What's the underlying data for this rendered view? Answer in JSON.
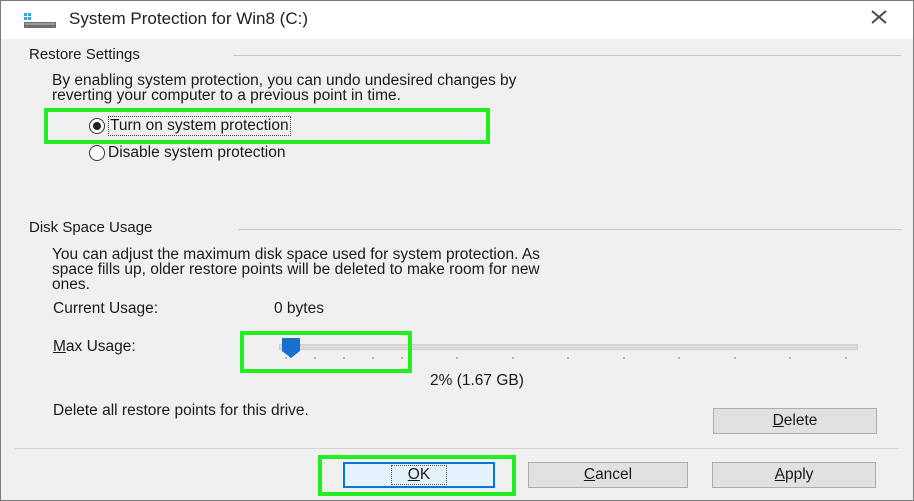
{
  "window": {
    "title": "System Protection for Win8 (C:)",
    "icon": "drive-icon",
    "close_icon": "close-icon"
  },
  "restore": {
    "heading": "Restore Settings",
    "description_line1": "By enabling system protection, you can undo undesired changes by",
    "description_line2": "reverting your computer to a previous point in time.",
    "option_on": "Turn on system protection",
    "option_off": "Disable system protection",
    "selected": "on"
  },
  "disk": {
    "heading": "Disk Space Usage",
    "description_line1": "You can adjust the maximum disk space used for system protection. As",
    "description_line2": "space fills up, older restore points will be deleted to make room for new",
    "description_line3": "ones.",
    "current_label": "Current Usage:",
    "current_value": "0 bytes",
    "max_label": "Max Usage:",
    "max_value": "2% (1.67 GB)",
    "slider_percent": 2,
    "delete_text": "Delete all restore points for this drive.",
    "delete_button": "Delete"
  },
  "buttons": {
    "ok": "OK",
    "cancel": "Cancel",
    "apply": "Apply"
  },
  "colors": {
    "highlight": "#22ee22",
    "slider_thumb": "#1a6fd1",
    "default_button_border": "#0078d7"
  }
}
